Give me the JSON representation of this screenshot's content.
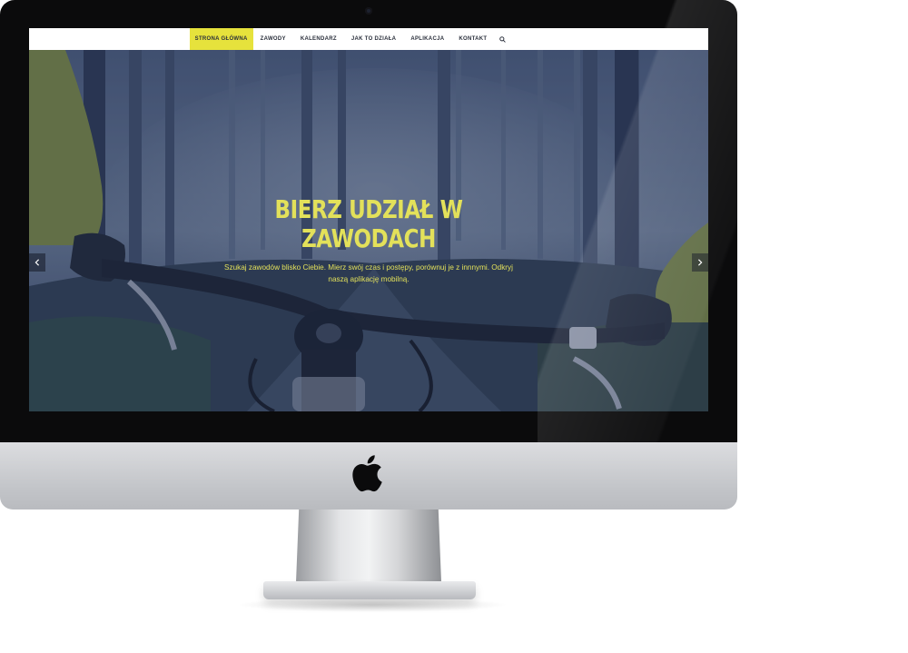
{
  "nav": {
    "items": [
      {
        "label": "STRONA GŁÓWNA",
        "active": true
      },
      {
        "label": "ZAWODY"
      },
      {
        "label": "KALENDARZ"
      },
      {
        "label": "JAK TO DZIAŁA"
      },
      {
        "label": "APLIKACJA"
      },
      {
        "label": "KONTAKT"
      }
    ],
    "search_icon": "search-icon"
  },
  "hero": {
    "title": "BIERZ UDZIAŁ W\nZAWODACH",
    "text": "Szukaj zawodów blisko Ciebie. Mierz swój czas i postępy, porównuj je z innnymi. Odkryj naszą aplikację mobilną.",
    "prev_icon": "chevron-left-icon",
    "next_icon": "chevron-right-icon"
  },
  "colors": {
    "accent": "#e6e23c",
    "nav_text": "#2a2f3b",
    "hero_overlay": "#2f3c60"
  },
  "device": {
    "logo_icon": "apple-logo-icon"
  }
}
